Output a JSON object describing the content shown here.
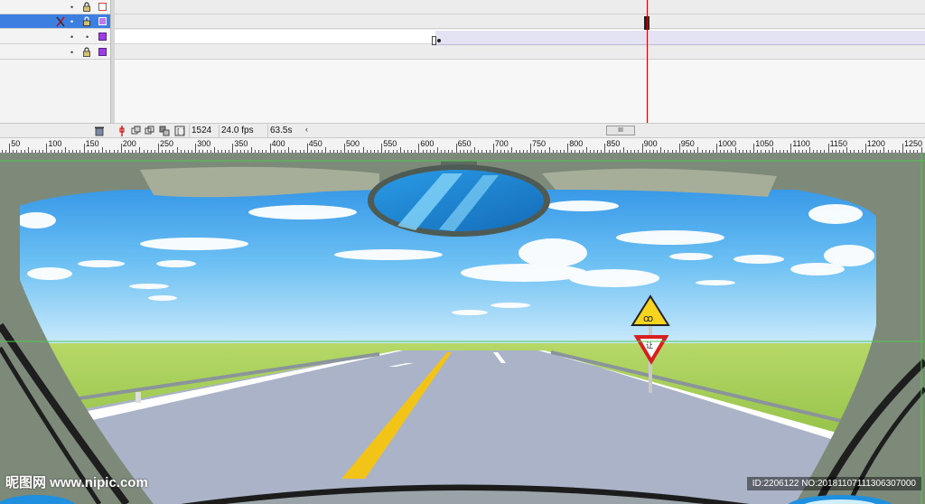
{
  "status_bar": {
    "current_frame": "1524",
    "frame_rate": "24.0 fps",
    "elapsed_time": "63.5s",
    "scroll_left_arrow": "‹",
    "scroll_thumb_grip": "III"
  },
  "layers": [
    {
      "eye": "•",
      "box_color": "#e03c3c",
      "box_filled": false
    },
    {
      "eye": "•",
      "box_color": "#9b3fe0",
      "box_filled": true,
      "selected": true,
      "editing": true
    },
    {
      "eye": "•",
      "box_color": "#9b3fe0",
      "box_filled": true
    },
    {
      "eye": "•",
      "box_color": "#9b3fe0",
      "box_filled": true
    }
  ],
  "ruler": {
    "labels": [
      "50",
      "100",
      "150",
      "200",
      "250",
      "300",
      "350",
      "400",
      "450",
      "500",
      "550",
      "600",
      "650",
      "700",
      "750",
      "800",
      "850",
      "900",
      "950",
      "1000",
      "1050",
      "1100",
      "1150",
      "1200",
      "1250"
    ]
  },
  "scene": {
    "sign_text": "让",
    "watermark_left": "昵图网 www.nipic.com",
    "watermark_id": "ID:2206122 NO:20181107111306307000",
    "colors": {
      "sky_top": "#2d8ee6",
      "sky_bottom": "#bfe6fb",
      "grass": "#9cc94a",
      "road": "#aab3c7",
      "interior": "#7d8a7a"
    }
  },
  "icons": {
    "trash": "trash-icon",
    "lock": "lock-icon",
    "pencil": "pencil-icon",
    "onion_skin": "onion-skin-icon",
    "center_frame": "center-frame-icon"
  }
}
